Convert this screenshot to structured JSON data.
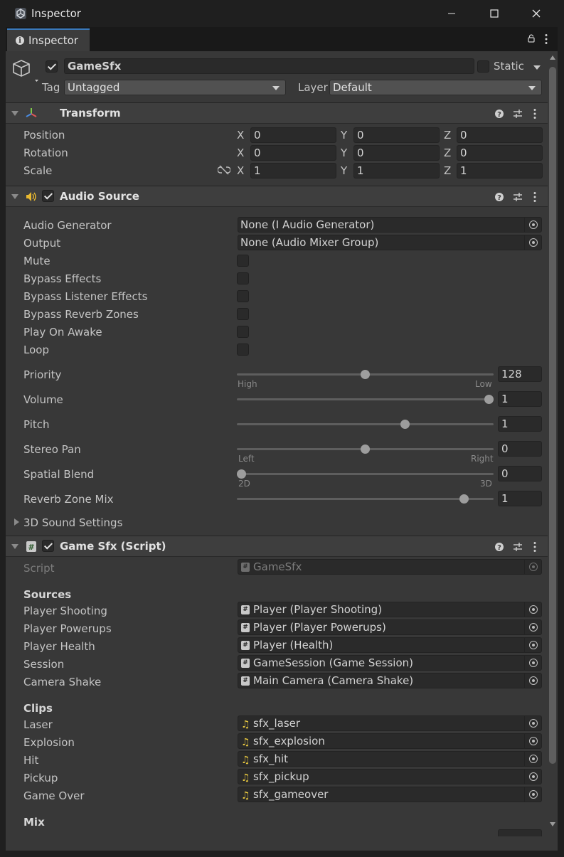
{
  "window": {
    "title": "Inspector",
    "tab_label": "Inspector"
  },
  "gameobject": {
    "name": "GameSfx",
    "active": true,
    "static_label": "Static",
    "static": false,
    "tag_label": "Tag",
    "tag_value": "Untagged",
    "layer_label": "Layer",
    "layer_value": "Default"
  },
  "transform": {
    "title": "Transform",
    "rows": [
      {
        "label": "Position",
        "x": "0",
        "y": "0",
        "z": "0"
      },
      {
        "label": "Rotation",
        "x": "0",
        "y": "0",
        "z": "0"
      },
      {
        "label": "Scale",
        "x": "1",
        "y": "1",
        "z": "1"
      }
    ],
    "axis_x": "X",
    "axis_y": "Y",
    "axis_z": "Z"
  },
  "audio_source": {
    "title": "Audio Source",
    "enabled": true,
    "audio_generator_label": "Audio Generator",
    "audio_generator_value": "None (I Audio Generator)",
    "output_label": "Output",
    "output_value": "None (Audio Mixer Group)",
    "toggles": [
      {
        "label": "Mute",
        "checked": false
      },
      {
        "label": "Bypass Effects",
        "checked": false
      },
      {
        "label": "Bypass Listener Effects",
        "checked": false
      },
      {
        "label": "Bypass Reverb Zones",
        "checked": false
      },
      {
        "label": "Play On Awake",
        "checked": false
      },
      {
        "label": "Loop",
        "checked": false
      }
    ],
    "sliders": [
      {
        "label": "Priority",
        "value": "128",
        "fraction": 0.5,
        "min_caption": "High",
        "max_caption": "Low"
      },
      {
        "label": "Volume",
        "value": "1",
        "fraction": 1.0,
        "min_caption": "",
        "max_caption": ""
      },
      {
        "label": "Pitch",
        "value": "1",
        "fraction": 0.66,
        "min_caption": "",
        "max_caption": ""
      },
      {
        "label": "Stereo Pan",
        "value": "0",
        "fraction": 0.5,
        "min_caption": "Left",
        "max_caption": "Right"
      },
      {
        "label": "Spatial Blend",
        "value": "0",
        "fraction": 0.0,
        "min_caption": "2D",
        "max_caption": "3D"
      },
      {
        "label": "Reverb Zone Mix",
        "value": "1",
        "fraction": 0.9,
        "min_caption": "",
        "max_caption": ""
      }
    ],
    "sound_settings_label": "3D Sound Settings"
  },
  "game_sfx": {
    "title": "Game Sfx (Script)",
    "enabled": true,
    "script_label": "Script",
    "script_value": "GameSfx",
    "sources_header": "Sources",
    "sources": [
      {
        "label": "Player Shooting",
        "value": "Player (Player Shooting)"
      },
      {
        "label": "Player Powerups",
        "value": "Player (Player Powerups)"
      },
      {
        "label": "Player Health",
        "value": "Player (Health)"
      },
      {
        "label": "Session",
        "value": "GameSession (Game Session)"
      },
      {
        "label": "Camera Shake",
        "value": "Main Camera (Camera Shake)"
      }
    ],
    "clips_header": "Clips",
    "clips": [
      {
        "label": "Laser",
        "value": "sfx_laser"
      },
      {
        "label": "Explosion",
        "value": "sfx_explosion"
      },
      {
        "label": "Hit",
        "value": "sfx_hit"
      },
      {
        "label": "Pickup",
        "value": "sfx_pickup"
      },
      {
        "label": "Game Over",
        "value": "sfx_gameover"
      }
    ],
    "mix_header": "Mix"
  },
  "icons": {
    "app": "unity-icon",
    "minimize": "minimize-icon",
    "maximize": "maximize-icon",
    "close": "close-icon",
    "lock": "lock-icon",
    "menu": "kebab-menu-icon",
    "gameobject": "cube-icon",
    "transform": "transform-icon",
    "audio": "speaker-icon",
    "script": "script-icon",
    "help": "help-icon",
    "presets": "presets-icon",
    "constrain": "unlinked-icon",
    "audioclip": "music-note-icon",
    "picker": "object-picker-icon"
  },
  "colors": {
    "accent": "#3a79bb",
    "panel": "#383838",
    "field": "#2a2a2a",
    "header": "#3e3e3e",
    "audio_icon": "#e8b830",
    "note_icon": "#e8c840"
  }
}
